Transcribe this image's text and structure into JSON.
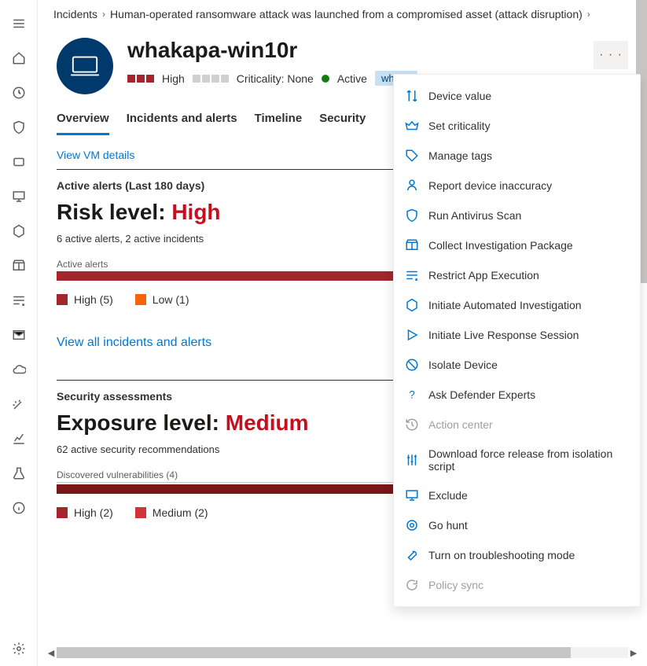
{
  "breadcrumb": {
    "first": "Incidents",
    "second": "Human-operated ransomware attack was launched from a compromised asset (attack disruption)"
  },
  "device": {
    "name": "whakapa-win10r",
    "risk_label": "High",
    "criticality_label": "Criticality: None",
    "status_label": "Active",
    "tag": "whaka"
  },
  "tabs": [
    "Overview",
    "Incidents and alerts",
    "Timeline",
    "Security"
  ],
  "active_tab": 0,
  "vm_link": "View VM details",
  "alerts": {
    "section_title": "Active alerts (Last 180 days)",
    "risk_prefix": "Risk level: ",
    "risk_value": "High",
    "summary": "6 active alerts, 2 active incidents",
    "chart_label": "Active alerts",
    "legend": [
      {
        "label": "High (5)",
        "color": "#a4262c"
      },
      {
        "label": "Low (1)",
        "color": "#f7630c"
      }
    ],
    "view_all_link": "View all incidents and alerts"
  },
  "assessments": {
    "section_title": "Security assessments",
    "exposure_prefix": "Exposure level: ",
    "exposure_value": "Medium",
    "summary": "62 active security recommendations",
    "chart_label": "Discovered vulnerabilities (4)",
    "legend": [
      {
        "label": "High (2)",
        "color": "#a4262c"
      },
      {
        "label": "Medium (2)",
        "color": "#d13438"
      }
    ]
  },
  "menu": {
    "items": [
      {
        "label": "Device value",
        "icon": "sort",
        "enabled": true
      },
      {
        "label": "Set criticality",
        "icon": "crown",
        "enabled": true
      },
      {
        "label": "Manage tags",
        "icon": "tag",
        "enabled": true
      },
      {
        "label": "Report device inaccuracy",
        "icon": "person",
        "enabled": true
      },
      {
        "label": "Run Antivirus Scan",
        "icon": "shield",
        "enabled": true
      },
      {
        "label": "Collect Investigation Package",
        "icon": "package",
        "enabled": true
      },
      {
        "label": "Restrict App Execution",
        "icon": "restrict",
        "enabled": true
      },
      {
        "label": "Initiate Automated Investigation",
        "icon": "hex",
        "enabled": true
      },
      {
        "label": "Initiate Live Response Session",
        "icon": "play",
        "enabled": true
      },
      {
        "label": "Isolate Device",
        "icon": "block",
        "enabled": true
      },
      {
        "label": "Ask Defender Experts",
        "icon": "question",
        "enabled": true
      },
      {
        "label": "Action center",
        "icon": "history",
        "enabled": false
      },
      {
        "label": "Download force release from isolation script",
        "icon": "sliders",
        "enabled": true
      },
      {
        "label": "Exclude",
        "icon": "monitor",
        "enabled": true
      },
      {
        "label": "Go hunt",
        "icon": "target",
        "enabled": true
      },
      {
        "label": "Turn on troubleshooting mode",
        "icon": "wrench",
        "enabled": true
      },
      {
        "label": "Policy sync",
        "icon": "sync",
        "enabled": false
      }
    ]
  },
  "chart_data": [
    {
      "type": "bar",
      "title": "Active alerts",
      "categories": [
        "High",
        "Low"
      ],
      "values": [
        5,
        1
      ],
      "colors": [
        "#a4262c",
        "#f7630c"
      ]
    },
    {
      "type": "bar",
      "title": "Discovered vulnerabilities (4)",
      "categories": [
        "High",
        "Medium"
      ],
      "values": [
        2,
        2
      ],
      "colors": [
        "#a4262c",
        "#d13438"
      ]
    }
  ]
}
